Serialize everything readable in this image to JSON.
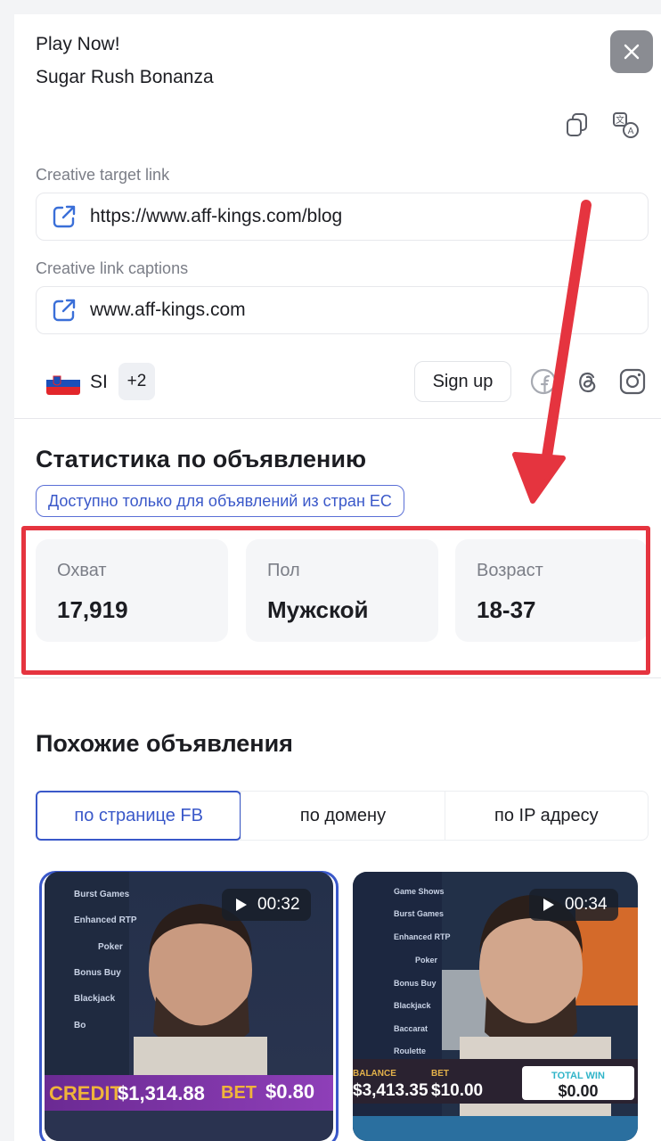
{
  "header": {
    "title_line1": "Play Now!",
    "title_line2": "Sugar Rush Bonanza"
  },
  "fields": {
    "target_link_label": "Creative target link",
    "target_link_value": "https://www.aff-kings.com/blog",
    "caption_label": "Creative link captions",
    "caption_value": "www.aff-kings.com"
  },
  "geo": {
    "country_code": "SI",
    "more_count": "+2"
  },
  "cta": {
    "signup_label": "Sign up"
  },
  "stats": {
    "section_title": "Статистика по объявлению",
    "eu_notice": "Доступно только для объявлений из стран ЕС",
    "cards": [
      {
        "label": "Охват",
        "value": "17,919"
      },
      {
        "label": "Пол",
        "value": "Мужской"
      },
      {
        "label": "Возраст",
        "value": "18-37"
      }
    ]
  },
  "similar": {
    "section_title": "Похожие объявления",
    "tabs": [
      {
        "label": "по странице FB"
      },
      {
        "label": "по домену"
      },
      {
        "label": "по IP адресу"
      }
    ],
    "videos": [
      {
        "duration": "00:32",
        "menu": [
          "Burst Games",
          "Enhanced RTP",
          "Poker",
          "Bonus Buy",
          "Blackjack",
          "Bo"
        ],
        "credit_label": "CREDIT",
        "credit_value": "$1,314.88",
        "bet_label": "BET",
        "bet_value": "$0.80"
      },
      {
        "duration": "00:34",
        "menu": [
          "Game Shows",
          "Burst Games",
          "Enhanced RTP",
          "Poker",
          "Bonus Buy",
          "Blackjack",
          "Baccarat",
          "Roulette"
        ],
        "balance_label": "BALANCE",
        "balance_value": "$3,413.35",
        "bet_label": "BET",
        "bet_value": "$10.00",
        "win_label": "TOTAL WIN",
        "win_value": "$0.00"
      }
    ]
  },
  "colors": {
    "accent": "#3a58c9",
    "highlight_red": "#e5343f",
    "card_bg": "#f5f6f8"
  }
}
